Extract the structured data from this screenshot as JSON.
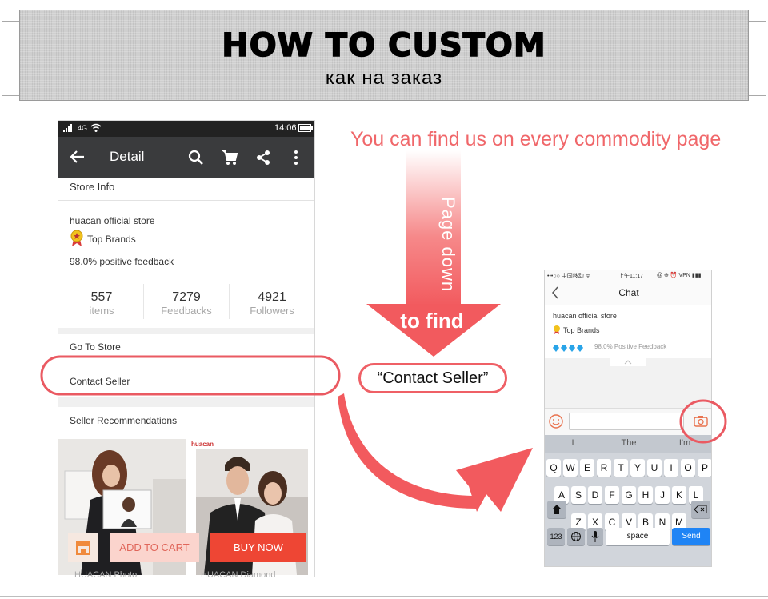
{
  "banner": {
    "title": "HOW TO CUSTOM",
    "subtitle": "как на заказ"
  },
  "caption": "You can find us on every commodity page",
  "arrow": {
    "text_vertical": "Page down",
    "text_find": "to find"
  },
  "contact_callout": "“Contact Seller”",
  "colors": {
    "accent": "#f0676a",
    "highlight_ring": "#ea5a62",
    "buy_button": "#ee4634",
    "app_bar": "#3a3b3d",
    "ios_blue": "#1f84f5"
  },
  "left_phone": {
    "status": {
      "signal": "4G",
      "time": "14:06"
    },
    "appbar": {
      "title": "Detail",
      "icons": [
        "back-arrow-icon",
        "search-icon",
        "cart-icon",
        "share-icon",
        "more-vertical-icon"
      ]
    },
    "store_info_label": "Store Info",
    "store_name": "huacan official store",
    "badge": "Top Brands",
    "positive_feedback": "98.0% positive feedback",
    "stats": [
      {
        "value": "557",
        "label": "items"
      },
      {
        "value": "7279",
        "label": "Feedbacks"
      },
      {
        "value": "4921",
        "label": "Followers"
      }
    ],
    "go_to_store": "Go To Store",
    "contact_seller": "Contact Seller",
    "seller_recommendations": "Seller Recommendations",
    "product_brand": "huacan",
    "footer_text": [
      "HUACAN Photo",
      "HUACAN Diamond"
    ],
    "add_to_cart": "ADD TO CART",
    "buy_now": "BUY NOW"
  },
  "right_phone": {
    "status": {
      "carrier": "•••○○ 中国移动 ᯤ",
      "time": "上午11:17",
      "right": "@ ⊕ ⏰ VPN ▮▮▮"
    },
    "title": "Chat",
    "store_name": "huacan official store",
    "badge": "Top Brands",
    "feedback": "98.0% Positive Feedback",
    "suggestions": [
      "I",
      "The",
      "I'm"
    ],
    "rows": [
      [
        "Q",
        "W",
        "E",
        "R",
        "T",
        "Y",
        "U",
        "I",
        "O",
        "P"
      ],
      [
        "A",
        "S",
        "D",
        "F",
        "G",
        "H",
        "J",
        "K",
        "L"
      ],
      [
        "Z",
        "X",
        "C",
        "V",
        "B",
        "N",
        "M"
      ]
    ],
    "key_123": "123",
    "space": "space",
    "send": "Send"
  }
}
